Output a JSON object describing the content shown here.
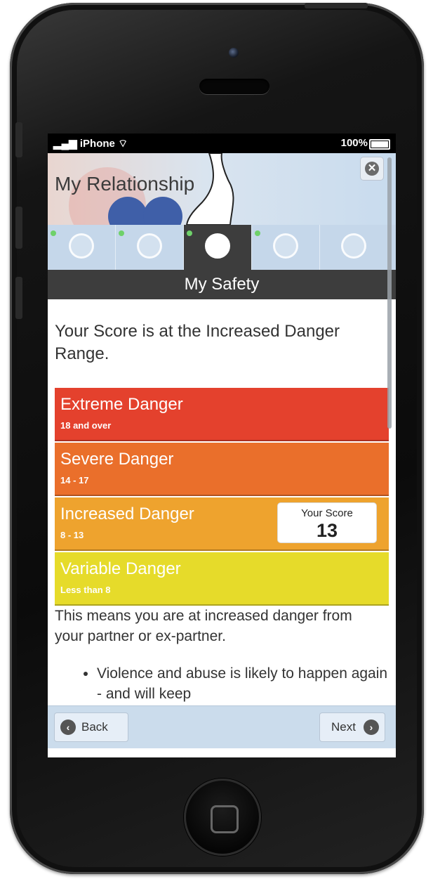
{
  "status_bar": {
    "carrier": "iPhone",
    "battery": "100%"
  },
  "header": {
    "title": "My Relationship"
  },
  "tabs": [
    {
      "name": "search",
      "icon": "search-icon",
      "active": false
    },
    {
      "name": "people",
      "icon": "people-icon",
      "active": false
    },
    {
      "name": "home",
      "icon": "house-icon",
      "active": true
    },
    {
      "name": "exchange",
      "icon": "exchange-arrows-icon",
      "active": false
    },
    {
      "name": "menu",
      "icon": "menu-list-icon",
      "active": false
    }
  ],
  "section_title": "My Safety",
  "intro": "Your Score is at the Increased Danger Range.",
  "danger_levels": [
    {
      "name": "Extreme Danger",
      "range": "18 and over",
      "color": "#e4412d"
    },
    {
      "name": "Severe Danger",
      "range": "14 - 17",
      "color": "#ea6f2b"
    },
    {
      "name": "Increased Danger",
      "range": "8 - 13",
      "color": "#eea32e"
    },
    {
      "name": "Variable Danger",
      "range": "Less than 8",
      "color": "#e6db2a"
    }
  ],
  "score": {
    "label": "Your Score",
    "value": "13"
  },
  "description": "This means you are at increased danger from your partner or ex-partner.",
  "bullets": [
    "Violence and abuse is likely to happen again - and will keep"
  ],
  "footer": {
    "back_label": "Back",
    "next_label": "Next"
  }
}
